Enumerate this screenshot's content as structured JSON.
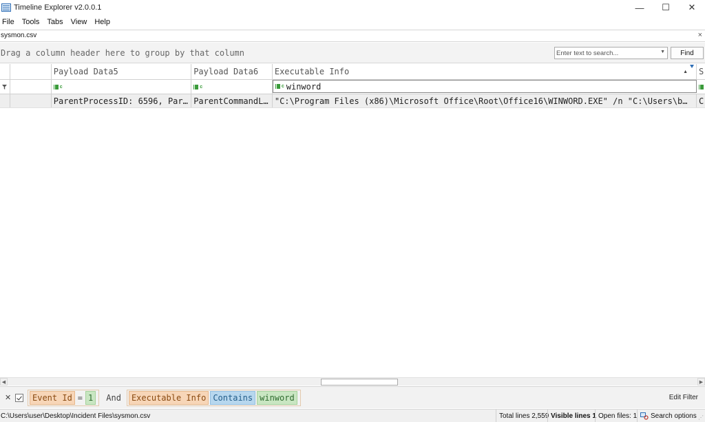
{
  "window": {
    "title": "Timeline Explorer v2.0.0.1",
    "controls": {
      "minimize": "—",
      "maximize": "☐",
      "close": "✕"
    }
  },
  "menu": {
    "items": [
      "File",
      "Tools",
      "Tabs",
      "View",
      "Help"
    ]
  },
  "tab": {
    "label": "sysmon.csv",
    "close": "×"
  },
  "group_panel": {
    "hint": "Drag a column header here to group by that column",
    "search_placeholder": "Enter text to search...",
    "find_label": "Find"
  },
  "grid": {
    "columns": [
      "Payload Data5",
      "Payload Data6",
      "Executable Info",
      "S"
    ],
    "filter_values": [
      "",
      "",
      "winword"
    ],
    "rows": [
      {
        "payload_data5": "ParentProcessID: 6596, Par…",
        "payload_data6": "ParentCommandL…",
        "executable_info": "\"C:\\Program Files (x86)\\Microsoft Office\\Root\\Office16\\WINWORD.EXE\" /n \"C:\\Users\\b…",
        "next": "C"
      }
    ]
  },
  "filter_panel": {
    "clear": "✕",
    "clause1": {
      "field": "Event Id",
      "op": "=",
      "value": "1"
    },
    "joiner": "And",
    "clause2": {
      "field": "Executable Info",
      "op": "Contains",
      "value": "winword"
    },
    "edit_label": "Edit Filter"
  },
  "status": {
    "path": "C:\\Users\\user\\Desktop\\Incident Files\\sysmon.csv",
    "total": "Total lines 2,559",
    "visible": "Visible lines 1",
    "open": "Open files: 1",
    "search": "Search options"
  },
  "colors": {
    "field_token": "#f7d6b8",
    "value_token": "#c9e6c2",
    "condition_token": "#b7d7ee",
    "accent": "#2d6db5"
  }
}
